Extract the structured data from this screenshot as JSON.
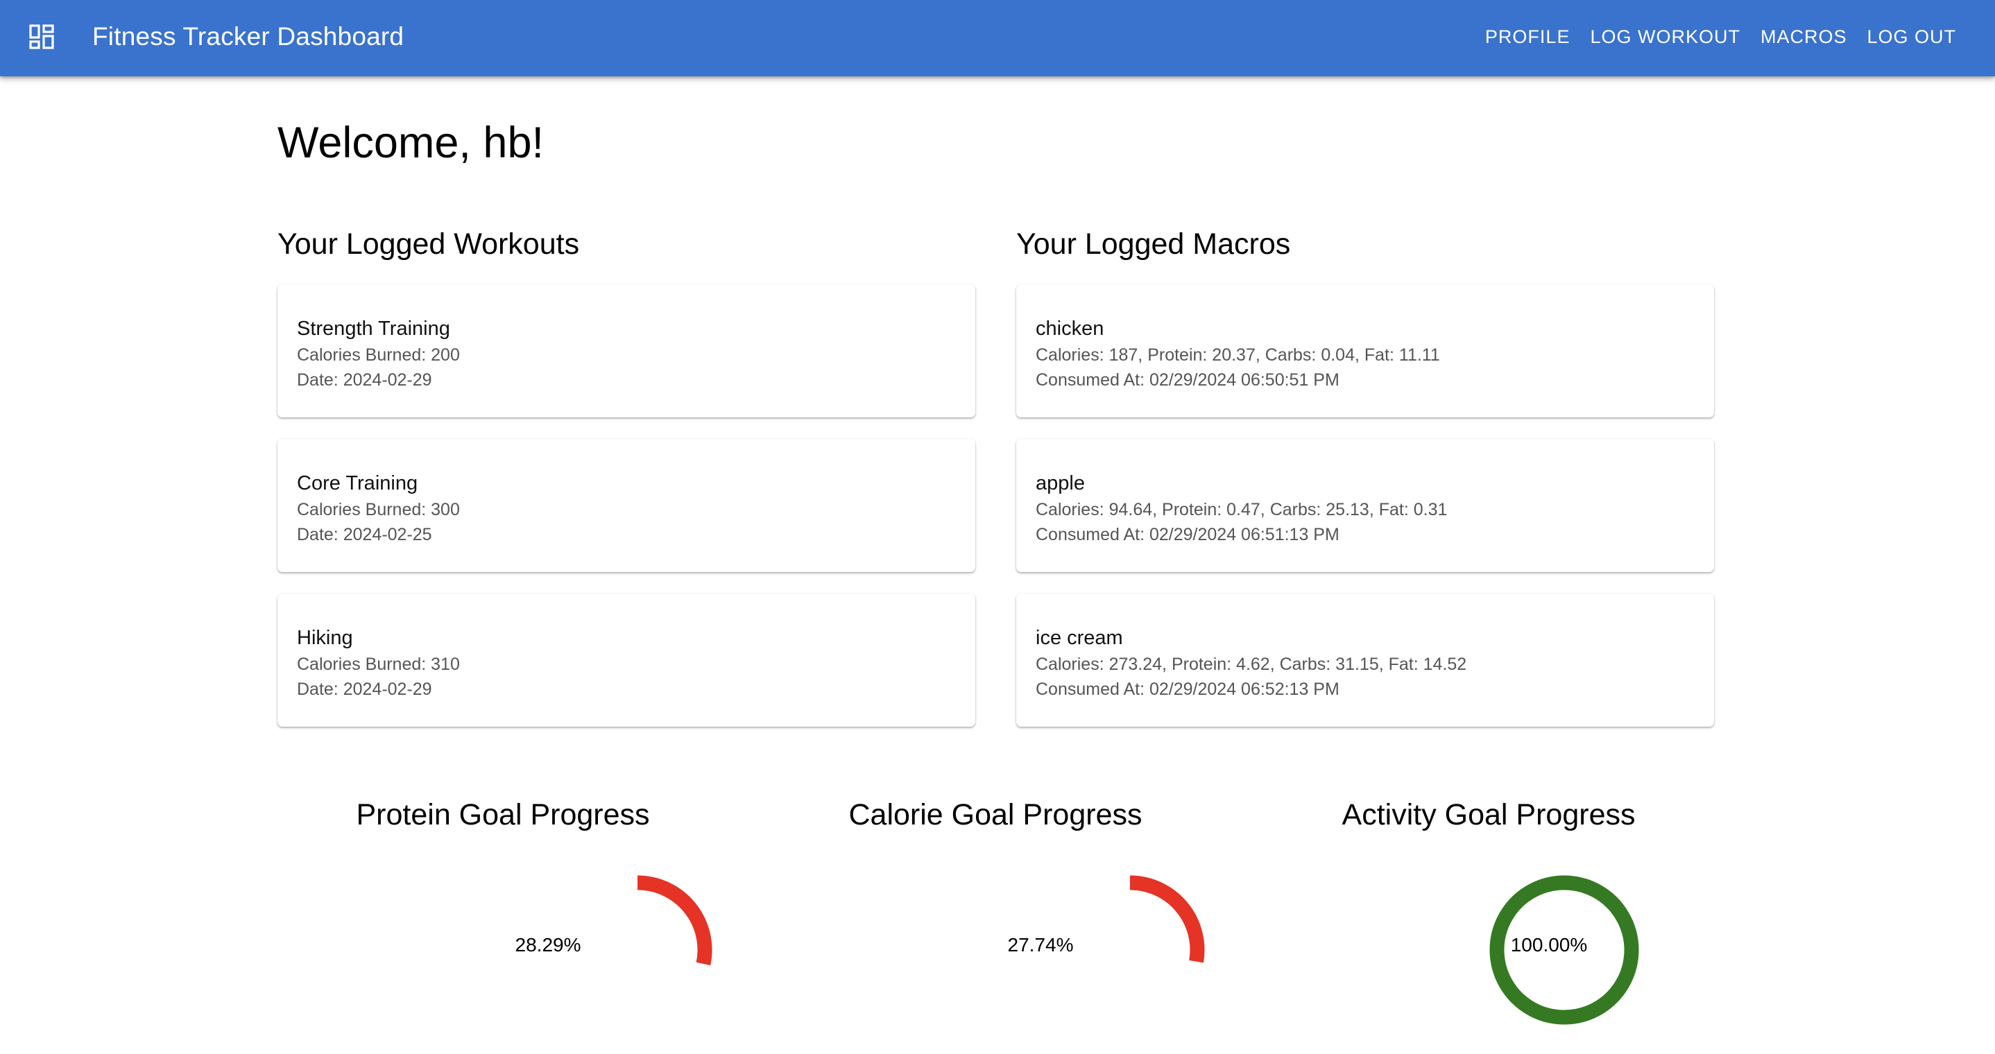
{
  "appbar": {
    "title": "Fitness Tracker Dashboard",
    "menu_icon": "dashboard-grid-icon",
    "nav": [
      "PROFILE",
      "LOG WORKOUT",
      "MACROS",
      "LOG OUT"
    ]
  },
  "welcome": "Welcome, hb!",
  "workouts": {
    "title": "Your Logged Workouts",
    "items": [
      {
        "name": "Strength Training",
        "calories": "Calories Burned: 200",
        "date": "Date: 2024-02-29"
      },
      {
        "name": "Core Training",
        "calories": "Calories Burned: 300",
        "date": "Date: 2024-02-25"
      },
      {
        "name": "Hiking",
        "calories": "Calories Burned: 310",
        "date": "Date: 2024-02-29"
      }
    ]
  },
  "macros": {
    "title": "Your Logged Macros",
    "items": [
      {
        "name": "chicken",
        "nutrition": "Calories: 187, Protein: 20.37, Carbs: 0.04, Fat: 11.11",
        "consumed": "Consumed At: 02/29/2024 06:50:51 PM"
      },
      {
        "name": "apple",
        "nutrition": "Calories: 94.64, Protein: 0.47, Carbs: 25.13, Fat: 0.31",
        "consumed": "Consumed At: 02/29/2024 06:51:13 PM"
      },
      {
        "name": "ice cream",
        "nutrition": "Calories: 273.24, Protein: 4.62, Carbs: 31.15, Fat: 14.52",
        "consumed": "Consumed At: 02/29/2024 06:52:13 PM"
      }
    ]
  },
  "goals": [
    {
      "title": "Protein Goal Progress",
      "label": "28.29%",
      "progress": 0.2829,
      "color": "#e53325"
    },
    {
      "title": "Calorie Goal Progress",
      "label": "27.74%",
      "progress": 0.2774,
      "color": "#e53325"
    },
    {
      "title": "Activity Goal Progress",
      "label": "100.00%",
      "progress": 1.0,
      "color": "#357a22"
    }
  ],
  "colors": {
    "appbar": "#3a73cd",
    "low_progress": "#e53325",
    "complete_progress": "#357a22"
  }
}
